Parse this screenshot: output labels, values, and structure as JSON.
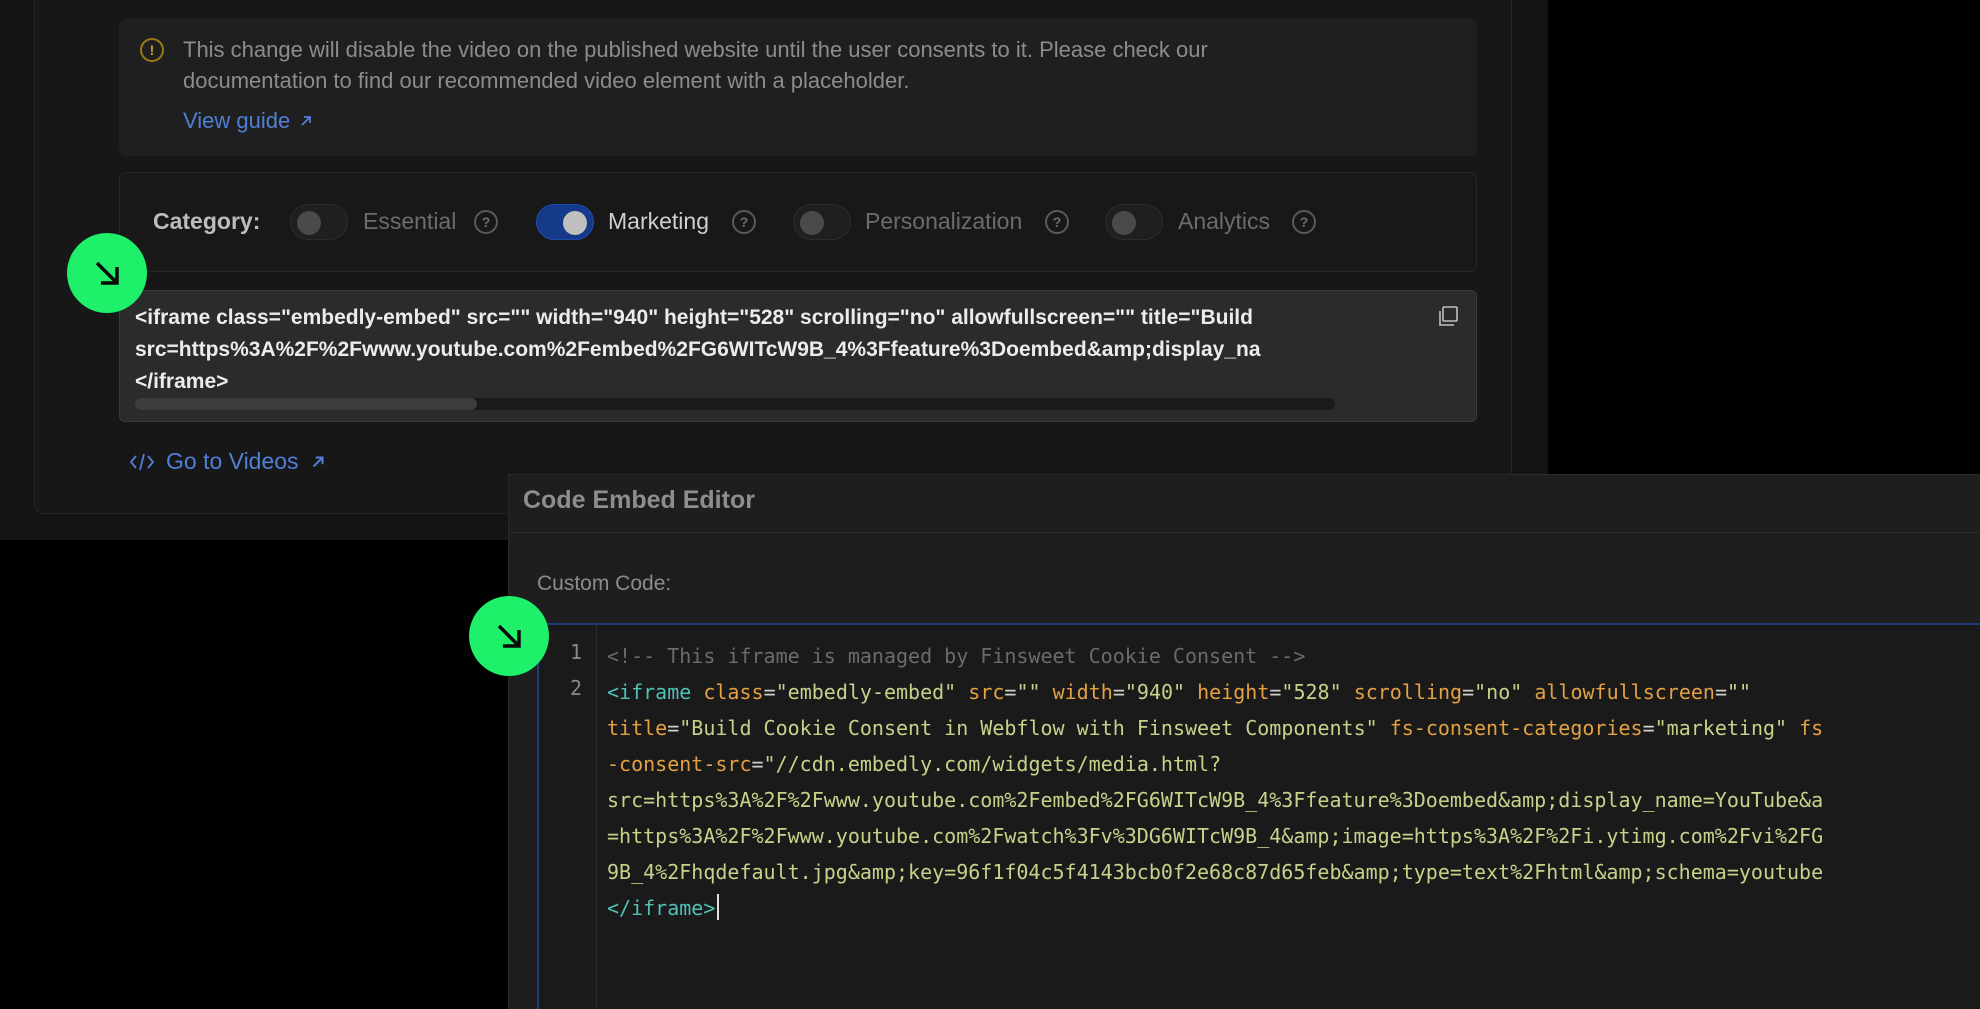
{
  "warning": {
    "text": "This change will disable the video on the published website until the user consents to it. Please check our documentation to find our recommended video element with a placeholder.",
    "link": "View guide"
  },
  "category": {
    "label": "Category:",
    "items": [
      {
        "label": "Essential",
        "on": false
      },
      {
        "label": "Marketing",
        "on": true
      },
      {
        "label": "Personalization",
        "on": false
      },
      {
        "label": "Analytics",
        "on": false
      }
    ]
  },
  "snippet": {
    "lines": [
      "<iframe class=\"embedly-embed\" src=\"\" width=\"940\" height=\"528\" scrolling=\"no\" allowfullscreen=\"\" title=\"Build",
      "src=https%3A%2F%2Fwww.youtube.com%2Fembed%2FG6WITcW9B_4%3Ffeature%3Doembed&amp;display_na",
      "</iframe>"
    ]
  },
  "videos_link": "Go to Videos",
  "editor": {
    "title": "Code Embed Editor",
    "custom_label": "Custom Code:",
    "line_numbers": [
      "1",
      "2"
    ],
    "code": {
      "comment": "<!-- This iframe is managed by Finsweet Cookie Consent -->",
      "tag_open": "<iframe",
      "a1": "class",
      "v1": "\"embedly-embed\"",
      "a2": "src",
      "v2": "\"\"",
      "a3": "width",
      "v3": "\"940\"",
      "a4": "height",
      "v4": "\"528\"",
      "a5": "scrolling",
      "v5": "\"no\"",
      "a6": "allowfullscreen",
      "v6": "\"\"",
      "a7": "title",
      "v7": "\"Build Cookie Consent in Webflow with Finsweet Components\"",
      "a8": "fs-consent-categories",
      "v8": "\"marketing\"",
      "a9a": "fs",
      "a9b": "consent-src",
      "v9": "\"//cdn.embedly.com/widgets/media.html?",
      "l4": "src=https%3A%2F%2Fwww.youtube.com%2Fembed%2FG6WITcW9B_4%3Ffeature%3Doembed&amp;display_name=YouTube&a",
      "l5": "=https%3A%2F%2Fwww.youtube.com%2Fwatch%3Fv%3DG6WITcW9B_4&amp;image=https%3A%2F%2Fi.ytimg.com%2Fvi%2FG",
      "l6": "9B_4%2Fhqdefault.jpg&amp;key=96f1f04c5f4143bcb0f2e68c87d65feb&amp;type=text%2Fhtml&amp;schema=youtube",
      "tag_close": "</iframe>"
    }
  },
  "colors": {
    "marker": "#1ef06a",
    "link": "#4f7fd6",
    "toggle_on": "#163a8a"
  }
}
